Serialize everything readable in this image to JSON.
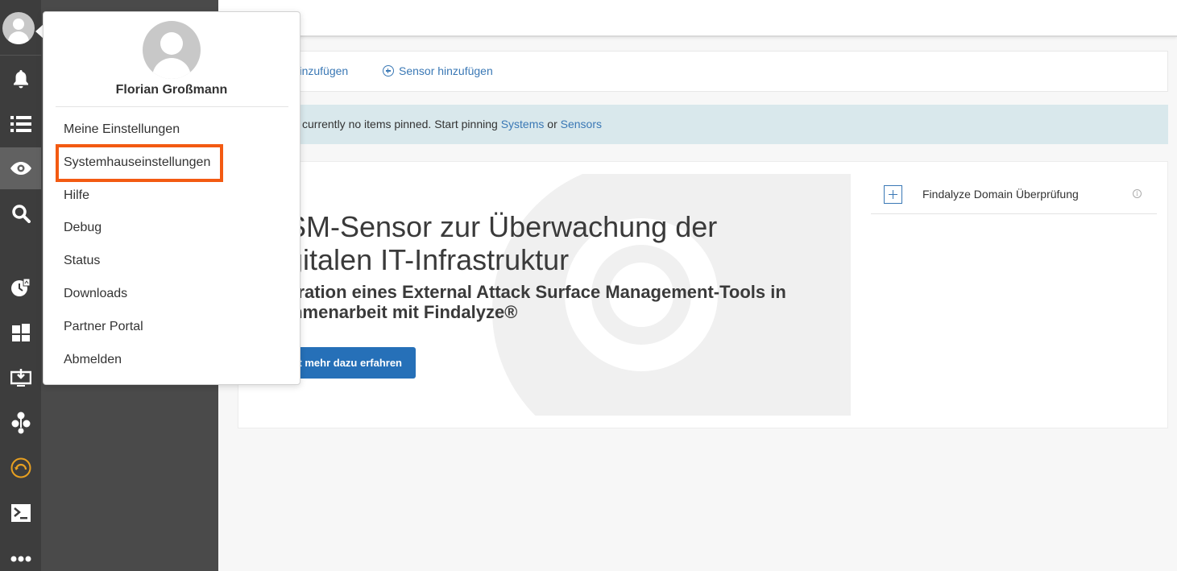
{
  "user": {
    "name": "Florian Großmann"
  },
  "user_menu": {
    "items": [
      "Meine Einstellungen",
      "Systemhauseinstellungen",
      "Hilfe",
      "Debug",
      "Status",
      "Downloads",
      "Partner Portal",
      "Abmelden"
    ],
    "highlighted_item": "Systemhauseinstellungen",
    "highlight_color": "#f35a12"
  },
  "nav_rail": {
    "icons": [
      "bell-icon",
      "list-icon",
      "eye-icon",
      "search-icon",
      "clock-report-icon",
      "dashboard-icon",
      "monitor-download-icon",
      "network-icon",
      "backup-icon",
      "terminal-icon",
      "more-icon"
    ],
    "active": "eye-icon"
  },
  "toolbar": {
    "add_system": "n hinzufügen",
    "add_sensor": "Sensor hinzufügen"
  },
  "info_bar": {
    "text_prefix": "currently no items pinned. Start pinning",
    "link_systems": "Systems",
    "text_or": "or",
    "link_sensors": "Sensors"
  },
  "hero": {
    "title_line1": "SM-Sensor zur Überwachung der",
    "title_line2": "gitalen IT-Infrastruktur",
    "subtitle_line1": "gration eines External Attack Surface Management-Tools in",
    "subtitle_line2": "mmenarbeit mit Findalyze®",
    "button": "t mehr dazu erfahren"
  },
  "side_list": {
    "item_label": "Findalyze Domain Überprüfung",
    "info_glyph": "i"
  },
  "colors": {
    "accent_blue": "#2670b8",
    "link_blue": "#3a78b5",
    "rail_bg": "#3d3d3d",
    "info_bg": "#d9e8ec"
  }
}
